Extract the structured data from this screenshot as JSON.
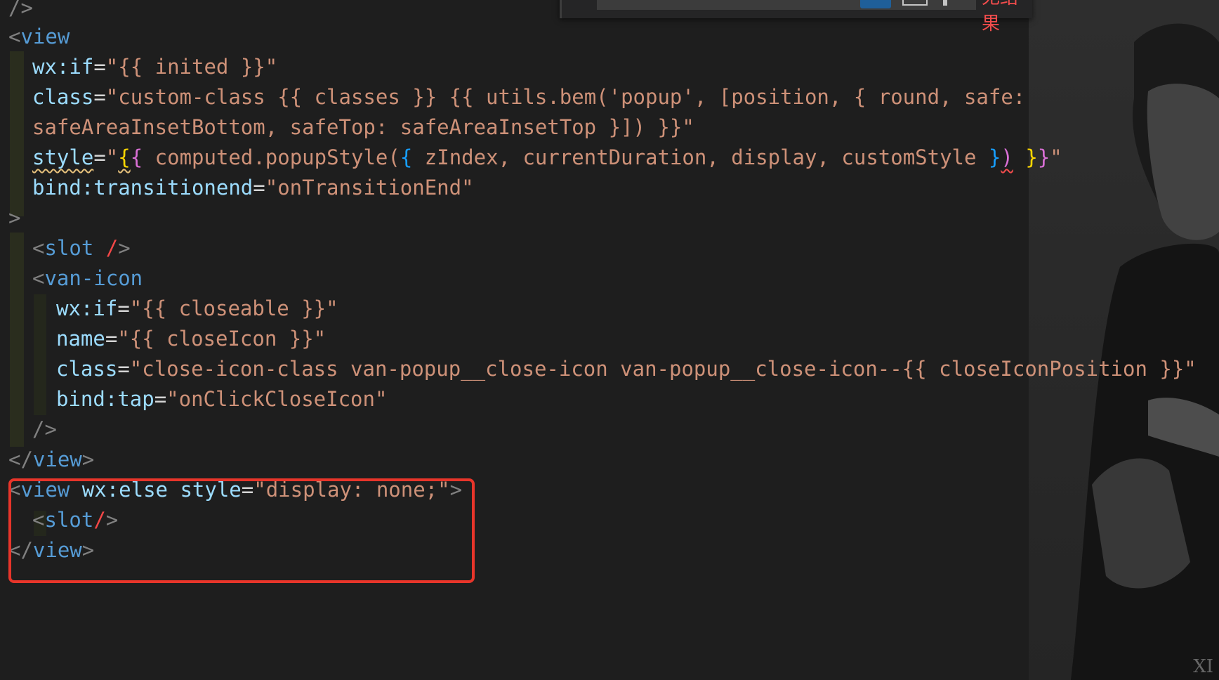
{
  "editor": {
    "find_widget": {
      "result_text": "无结果"
    },
    "watermark": "XI",
    "lines": [
      {
        "id": "l0",
        "tokens": [
          "/>"
        ]
      },
      {
        "id": "l1",
        "tokens": [
          "<",
          "view"
        ]
      },
      {
        "id": "l2",
        "tokens": [
          "wx:if",
          "=",
          "\"{{ inited }}\""
        ]
      },
      {
        "id": "l3",
        "tokens": [
          "class",
          "=",
          "\"custom-class {{ classes }} {{ utils.bem('popup', [position, { round, safe:"
        ]
      },
      {
        "id": "l4",
        "tokens": [
          "safeAreaInsetBottom, safeTop: safeAreaInsetTop }]) }}\""
        ]
      },
      {
        "id": "l5",
        "tokens": [
          "style",
          "=",
          "\"",
          "{",
          "{",
          " computed.popupStyle(",
          "{",
          " zIndex, currentDuration, display, customStyle ",
          "}",
          ")",
          " ",
          "}",
          "}",
          "\""
        ]
      },
      {
        "id": "l6",
        "tokens": [
          "bind:transitionend",
          "=",
          "\"onTransitionEnd\""
        ]
      },
      {
        "id": "l7",
        "tokens": [
          ">"
        ]
      },
      {
        "id": "l8",
        "tokens": [
          "<",
          "slot",
          " ",
          "/",
          ">"
        ]
      },
      {
        "id": "l9",
        "tokens": [
          "<",
          "van-icon"
        ]
      },
      {
        "id": "l10",
        "tokens": [
          "wx:if",
          "=",
          "\"{{ closeable }}\""
        ]
      },
      {
        "id": "l11",
        "tokens": [
          "name",
          "=",
          "\"{{ closeIcon }}\""
        ]
      },
      {
        "id": "l12",
        "tokens": [
          "class",
          "=",
          "\"close-icon-class van-popup__close-icon van-popup__close-icon--{{ closeIconPosition }}\""
        ]
      },
      {
        "id": "l13",
        "tokens": [
          "bind:tap",
          "=",
          "\"onClickCloseIcon\""
        ]
      },
      {
        "id": "l14",
        "tokens": [
          "/>"
        ]
      },
      {
        "id": "l15",
        "tokens": [
          "</",
          "view",
          ">"
        ]
      },
      {
        "id": "l16",
        "tokens": [
          "<",
          "view",
          " ",
          "wx:else",
          " ",
          "style",
          "=",
          "\"display: none;\"",
          ">"
        ]
      },
      {
        "id": "l17",
        "tokens": [
          "<",
          "slot",
          "/",
          ">"
        ]
      },
      {
        "id": "l18",
        "tokens": [
          "</",
          "view",
          ">"
        ]
      }
    ]
  }
}
